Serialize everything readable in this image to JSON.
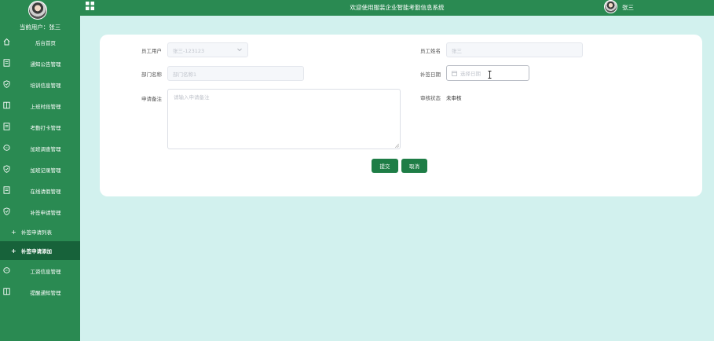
{
  "sidebar": {
    "current_user_label": "当前用户：张三",
    "items": [
      {
        "label": "后台首页",
        "icon": "home-icon"
      },
      {
        "label": "通知公告管理",
        "icon": "document-icon"
      },
      {
        "label": "培训信息管理",
        "icon": "shield-icon"
      },
      {
        "label": "上班时段管理",
        "icon": "columns-icon"
      },
      {
        "label": "考勤打卡管理",
        "icon": "document-icon"
      },
      {
        "label": "加班调查管理",
        "icon": "chat-icon"
      },
      {
        "label": "加班记录管理",
        "icon": "shield-icon"
      },
      {
        "label": "在线请假管理",
        "icon": "document-icon"
      },
      {
        "label": "补签申请管理",
        "icon": "shield-icon"
      }
    ],
    "sub_items": [
      {
        "label": "补签申请列表"
      },
      {
        "label": "补签申请添加"
      }
    ],
    "items_after": [
      {
        "label": "工资信息管理",
        "icon": "chat-icon"
      },
      {
        "label": "提醒通知管理",
        "icon": "columns-icon"
      }
    ]
  },
  "header": {
    "title": "欢迎使用服装企业智能考勤信息系统",
    "user_name": "张三"
  },
  "form": {
    "employee_user_label": "员工用户",
    "employee_user_value": "张三-123123",
    "employee_name_label": "员工姓名",
    "employee_name_value": "张三",
    "department_label": "部门名称",
    "department_value": "部门名称1",
    "sign_date_label": "补签日期",
    "sign_date_placeholder": "选择日期",
    "remark_label": "申请备注",
    "remark_placeholder": "请输入申请备注",
    "review_status_label": "审核状态",
    "review_status_value": "未审核",
    "submit_label": "提交",
    "cancel_label": "取消"
  },
  "colors": {
    "primary": "#2a8a52",
    "active_sub": "#17623a",
    "background": "#d2f1ee"
  }
}
